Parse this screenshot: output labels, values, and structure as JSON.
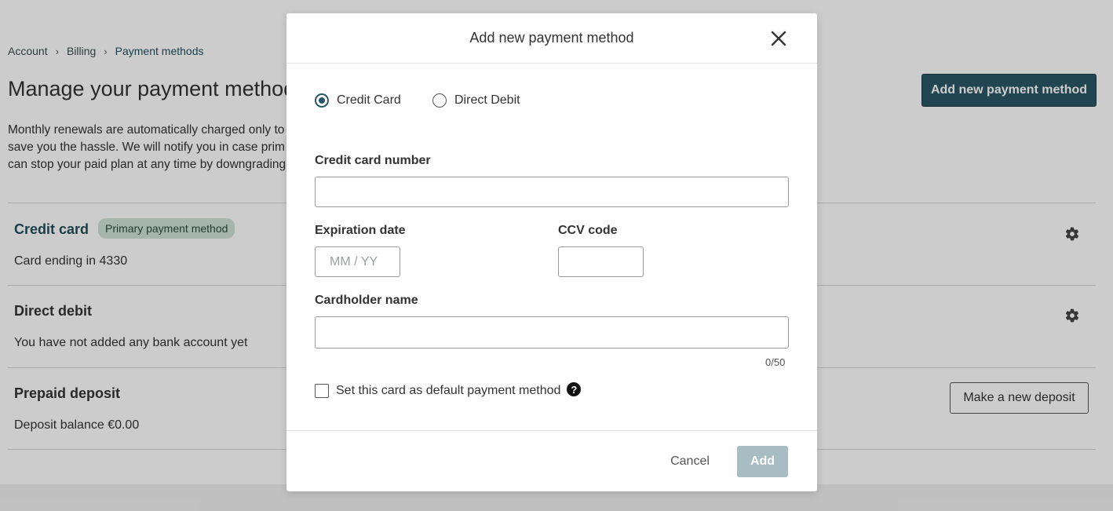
{
  "breadcrumb": {
    "items": [
      "Account",
      "Billing",
      "Payment methods"
    ]
  },
  "page": {
    "title": "Manage your payment methods",
    "intro_lines": [
      "Monthly renewals are automatically charged only to",
      "save you the hassle. We will notify you in case prim",
      "can stop your paid plan at any time by downgrading"
    ],
    "add_button": "Add new payment method"
  },
  "sections": {
    "credit_card": {
      "title": "Credit card",
      "badge": "Primary payment method",
      "sub": "Card ending in 4330"
    },
    "direct_debit": {
      "title": "Direct debit",
      "sub": "You have not added any bank account yet"
    },
    "prepaid": {
      "title": "Prepaid deposit",
      "sub": "Deposit balance €0.00",
      "button": "Make a new deposit"
    }
  },
  "modal": {
    "title": "Add new payment method",
    "payment_types": [
      {
        "label": "Credit Card",
        "checked": true
      },
      {
        "label": "Direct Debit",
        "checked": false
      }
    ],
    "fields": {
      "card_number": {
        "label": "Credit card number",
        "value": "",
        "placeholder": ""
      },
      "expiration": {
        "label": "Expiration date",
        "value": "",
        "placeholder": "MM / YY"
      },
      "ccv": {
        "label": "CCV code",
        "value": "",
        "placeholder": ""
      },
      "cardholder": {
        "label": "Cardholder name",
        "value": "",
        "placeholder": "",
        "counter": "0/50"
      }
    },
    "default_checkbox": {
      "label": "Set this card as default payment method",
      "checked": false
    },
    "cancel_label": "Cancel",
    "add_label": "Add"
  },
  "colors": {
    "accent": "#2a5766",
    "badge_bg": "#cfe3d8",
    "add_disabled": "#a7bdc3"
  },
  "icons": [
    "chevron-right-icon",
    "gear-icon",
    "close-icon",
    "help-icon"
  ]
}
